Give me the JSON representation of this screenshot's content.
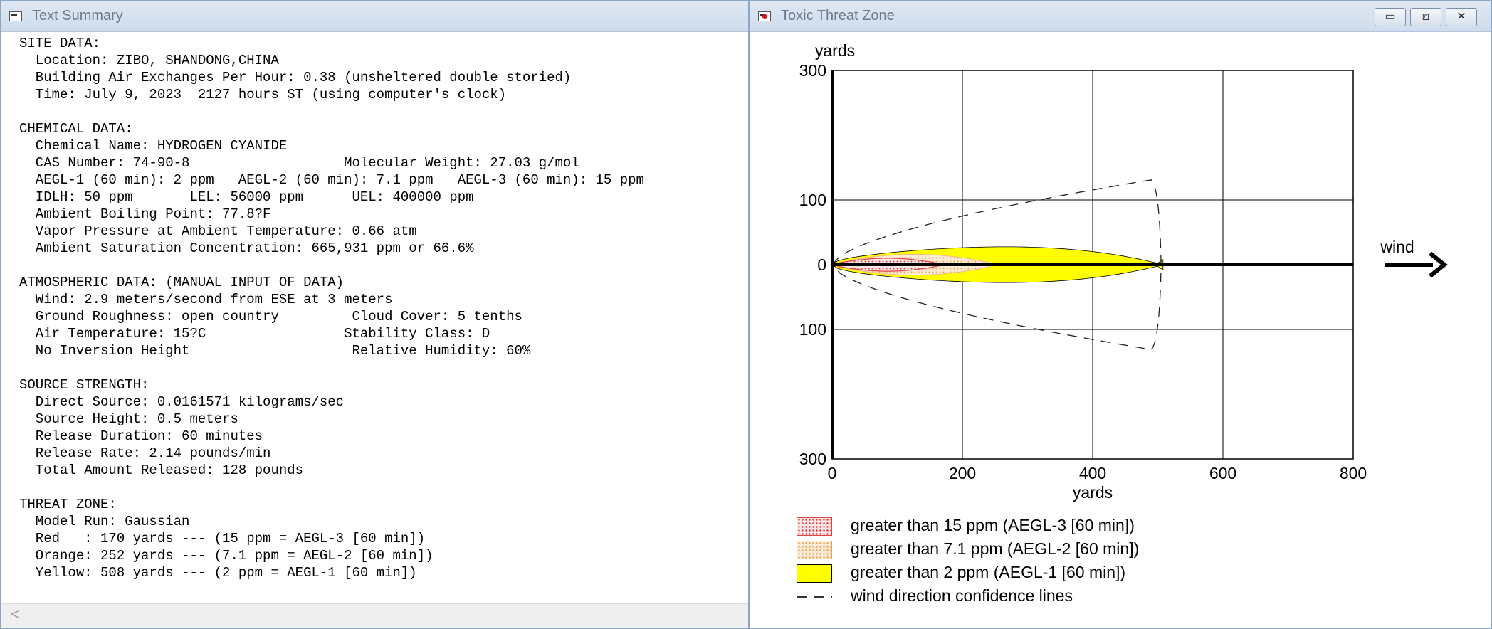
{
  "summary_window": {
    "title": "Text Summary",
    "lines": [
      "SITE DATA:",
      "  Location: ZIBO, SHANDONG,CHINA",
      "  Building Air Exchanges Per Hour: 0.38 (unsheltered double storied)",
      "  Time: July 9, 2023  2127 hours ST (using computer's clock)",
      "",
      "CHEMICAL DATA:",
      "  Chemical Name: HYDROGEN CYANIDE",
      "  CAS Number: 74-90-8                   Molecular Weight: 27.03 g/mol",
      "  AEGL-1 (60 min): 2 ppm   AEGL-2 (60 min): 7.1 ppm   AEGL-3 (60 min): 15 ppm",
      "  IDLH: 50 ppm       LEL: 56000 ppm      UEL: 400000 ppm",
      "  Ambient Boiling Point: 77.8?F",
      "  Vapor Pressure at Ambient Temperature: 0.66 atm",
      "  Ambient Saturation Concentration: 665,931 ppm or 66.6%",
      "",
      "ATMOSPHERIC DATA: (MANUAL INPUT OF DATA)",
      "  Wind: 2.9 meters/second from ESE at 3 meters",
      "  Ground Roughness: open country         Cloud Cover: 5 tenths",
      "  Air Temperature: 15?C                 Stability Class: D",
      "  No Inversion Height                    Relative Humidity: 60%",
      "",
      "SOURCE STRENGTH:",
      "  Direct Source: 0.0161571 kilograms/sec",
      "  Source Height: 0.5 meters",
      "  Release Duration: 60 minutes",
      "  Release Rate: 2.14 pounds/min",
      "  Total Amount Released: 128 pounds",
      "",
      "THREAT ZONE:",
      "  Model Run: Gaussian",
      "  Red   : 170 yards --- (15 ppm = AEGL-3 [60 min])",
      "  Orange: 252 yards --- (7.1 ppm = AEGL-2 [60 min])",
      "  Yellow: 508 yards --- (2 ppm = AEGL-1 [60 min])"
    ],
    "scroll_arrow": "<"
  },
  "threat_window": {
    "title": "Toxic Threat Zone",
    "buttons": {
      "minimize": "▭",
      "maximize": "⧈",
      "close": "✕"
    },
    "wind_label": "wind",
    "legend": [
      {
        "label": "greater than 15 ppm (AEGL-3 [60 min])",
        "color": "#e04040"
      },
      {
        "label": "greater than 7.1 ppm (AEGL-2 [60 min])",
        "color": "#f2b27a"
      },
      {
        "label": "greater than 2 ppm (AEGL-1 [60 min])",
        "color": "#ffff00"
      },
      {
        "label": "wind direction confidence lines",
        "color": "#333333"
      }
    ]
  },
  "chart_data": {
    "type": "area",
    "xlabel": "yards",
    "ylabel": "yards",
    "xlim": [
      0,
      800
    ],
    "ylim": [
      -300,
      300
    ],
    "xticks": [
      "0",
      "200",
      "400",
      "600",
      "800"
    ],
    "yticks": [
      "300",
      "100",
      "0",
      "100",
      "300"
    ],
    "grid": true,
    "zones": [
      {
        "name": "AEGL-3 red",
        "length": 170,
        "half_width": 10
      },
      {
        "name": "AEGL-2 orange",
        "length": 252,
        "half_width": 16
      },
      {
        "name": "AEGL-1 yellow",
        "length": 508,
        "half_width": 33
      }
    ],
    "confidence_line_half_width": 131
  }
}
